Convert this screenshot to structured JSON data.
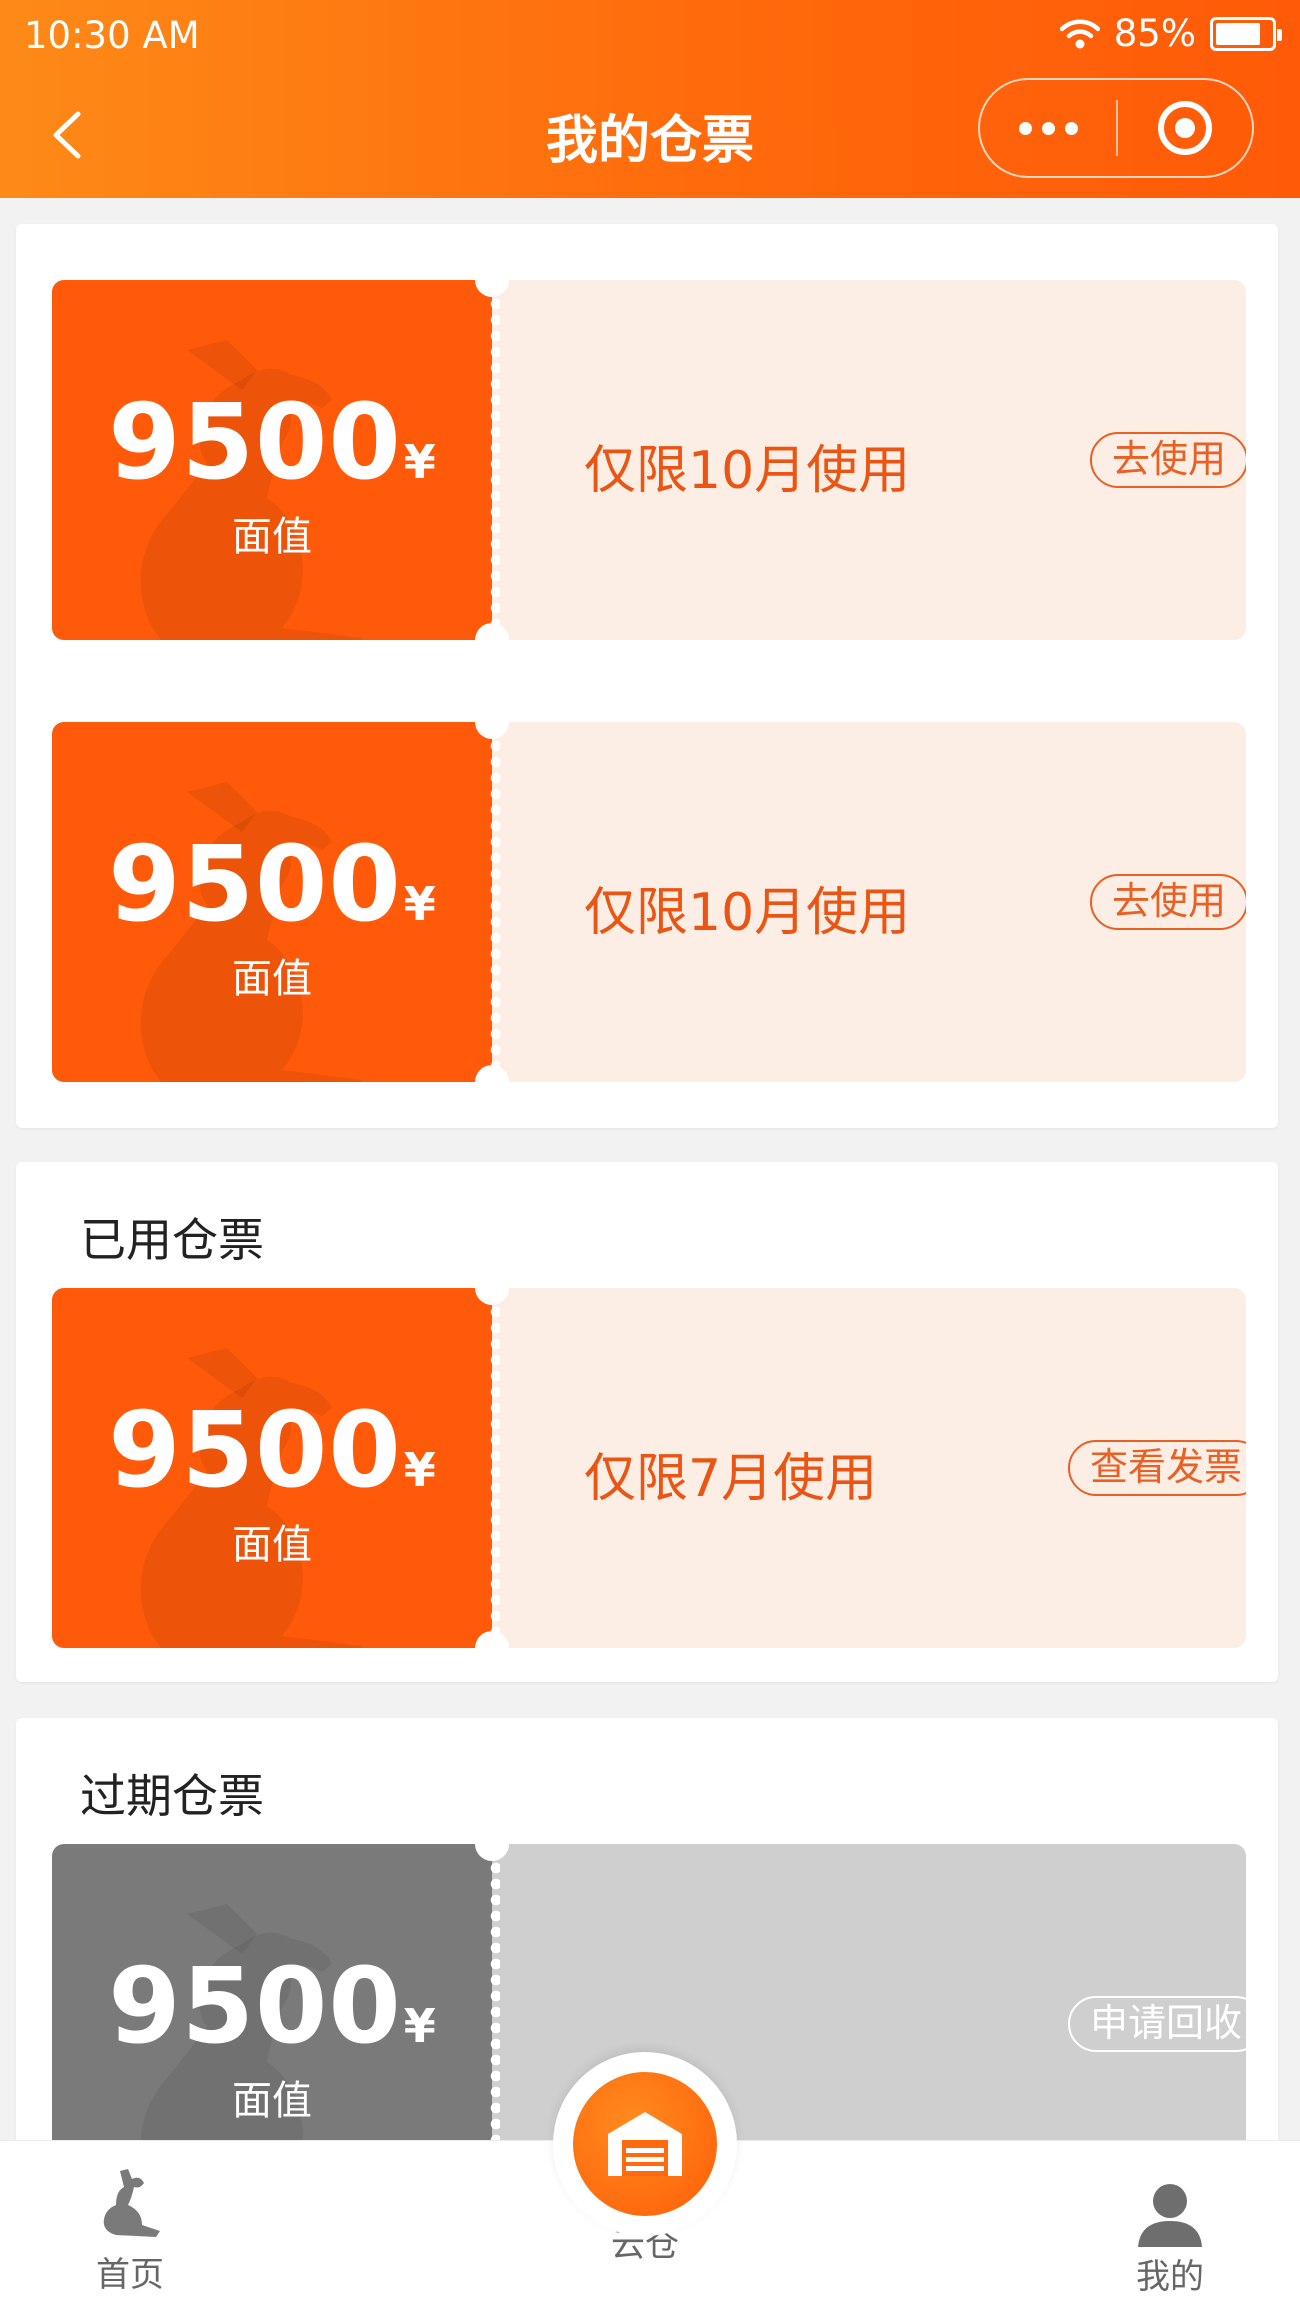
{
  "status_bar": {
    "time": "10:30 AM",
    "battery": "85%"
  },
  "nav": {
    "title": "我的仓票"
  },
  "active_tickets": [
    {
      "amount": "9500",
      "currency": "¥",
      "amount_label": "面值",
      "limit": "仅限10月使用",
      "action": "去使用"
    },
    {
      "amount": "9500",
      "currency": "¥",
      "amount_label": "面值",
      "limit": "仅限10月使用",
      "action": "去使用"
    }
  ],
  "used_section": {
    "title": "已用仓票",
    "ticket": {
      "amount": "9500",
      "currency": "¥",
      "amount_label": "面值",
      "limit": "仅限7月使用",
      "action": "查看发票"
    }
  },
  "expired_section": {
    "title": "过期仓票",
    "ticket": {
      "amount": "9500",
      "currency": "¥",
      "amount_label": "面值",
      "action": "申请回收"
    }
  },
  "tabbar": {
    "home": {
      "label": "首页",
      "icon": "kangaroo-icon"
    },
    "center": {
      "label": "云仓",
      "icon": "warehouse-icon"
    },
    "mine": {
      "label": "我的",
      "icon": "user-icon"
    }
  },
  "colors": {
    "accent": "#ff5a0a",
    "ticket_bg": "#fdeee5",
    "expired": "#7a7a7a"
  }
}
